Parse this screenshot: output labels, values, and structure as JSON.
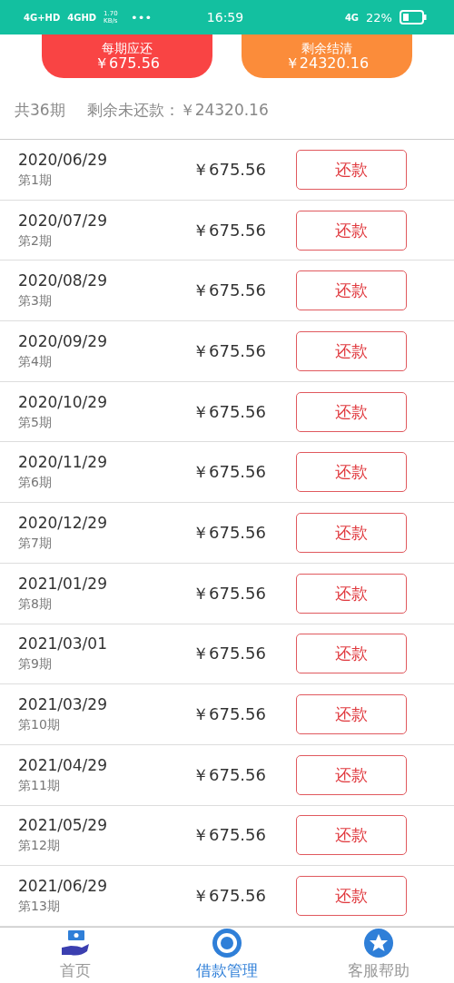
{
  "status_bar": {
    "network_1": "4G+HD",
    "network_2": "4GHD",
    "speed": "1.70 KB/s",
    "more": "•••",
    "time": "16:59",
    "network_3": "4G",
    "battery": "22%"
  },
  "summary_buttons": [
    {
      "title": "每期应还",
      "amount": "￥675.56",
      "color": "#f94444"
    },
    {
      "title": "剩余结清",
      "amount": "￥24320.16",
      "color": "#fb8c3a"
    }
  ],
  "summary": {
    "periods": "共36期",
    "remaining": "剩余未还款：￥24320.16"
  },
  "installments": [
    {
      "date": "2020/06/29",
      "period": "第1期",
      "amount": "￥675.56",
      "action": "还款"
    },
    {
      "date": "2020/07/29",
      "period": "第2期",
      "amount": "￥675.56",
      "action": "还款"
    },
    {
      "date": "2020/08/29",
      "period": "第3期",
      "amount": "￥675.56",
      "action": "还款"
    },
    {
      "date": "2020/09/29",
      "period": "第4期",
      "amount": "￥675.56",
      "action": "还款"
    },
    {
      "date": "2020/10/29",
      "period": "第5期",
      "amount": "￥675.56",
      "action": "还款"
    },
    {
      "date": "2020/11/29",
      "period": "第6期",
      "amount": "￥675.56",
      "action": "还款"
    },
    {
      "date": "2020/12/29",
      "period": "第7期",
      "amount": "￥675.56",
      "action": "还款"
    },
    {
      "date": "2021/01/29",
      "period": "第8期",
      "amount": "￥675.56",
      "action": "还款"
    },
    {
      "date": "2021/03/01",
      "period": "第9期",
      "amount": "￥675.56",
      "action": "还款"
    },
    {
      "date": "2021/03/29",
      "period": "第10期",
      "amount": "￥675.56",
      "action": "还款"
    },
    {
      "date": "2021/04/29",
      "period": "第11期",
      "amount": "￥675.56",
      "action": "还款"
    },
    {
      "date": "2021/05/29",
      "period": "第12期",
      "amount": "￥675.56",
      "action": "还款"
    },
    {
      "date": "2021/06/29",
      "period": "第13期",
      "amount": "￥675.56",
      "action": "还款"
    }
  ],
  "bottom_nav": [
    {
      "label": "首页",
      "selected": false
    },
    {
      "label": "借款管理",
      "selected": true
    },
    {
      "label": "客服帮助",
      "selected": false
    }
  ]
}
